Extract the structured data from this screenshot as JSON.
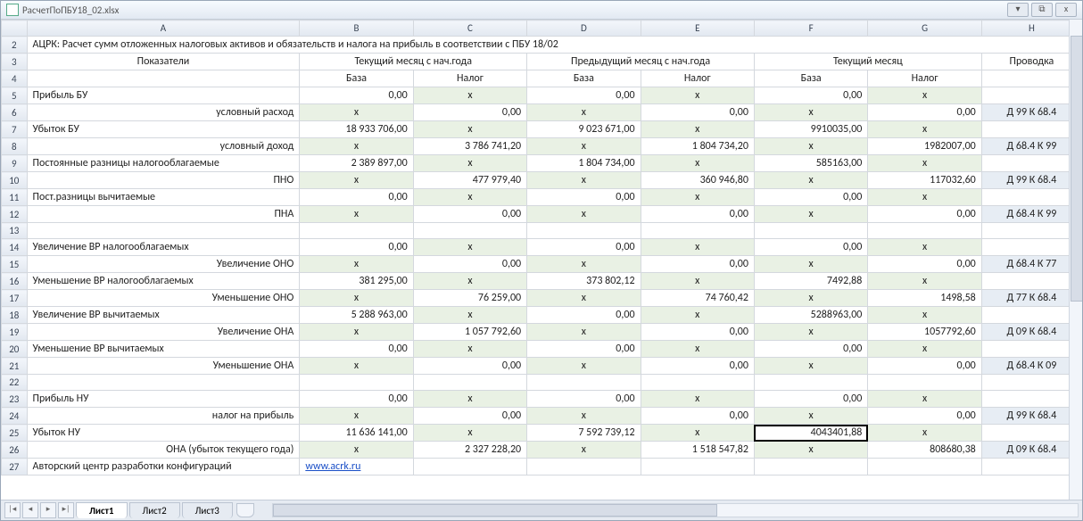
{
  "window": {
    "title": "РасчетПоПБУ18_02.xlsx",
    "btn_min": "▾",
    "btn_restore": "⧉",
    "btn_close": "x"
  },
  "columns": [
    "",
    "A",
    "B",
    "C",
    "D",
    "E",
    "F",
    "G",
    "H"
  ],
  "header_rows": {
    "r2": "АЦРК: Расчет сумм отложенных налоговых активов и обязательств и налога на прибыль в соответствии с ПБУ 18/02",
    "r3": {
      "A": "Показатели",
      "BC": "Текущий месяц с нач.года",
      "DE": "Предыдущий месяц с нач.года",
      "FG": "Текущий месяц",
      "H": "Проводка"
    },
    "r4": {
      "B": "База",
      "C": "Налог",
      "D": "База",
      "E": "Налог",
      "F": "База",
      "G": "Налог"
    }
  },
  "rows": [
    {
      "n": 5,
      "A": "Прибыль БУ",
      "Aalign": "left",
      "B": "0,00",
      "C": "x",
      "D": "0,00",
      "E": "x",
      "F": "0,00",
      "G": "x",
      "H": ""
    },
    {
      "n": 6,
      "A": "условный расход",
      "Aalign": "right",
      "B": "x",
      "C": "0,00",
      "D": "x",
      "E": "0,00",
      "F": "x",
      "G": "0,00",
      "H": "Д 99 К 68.4"
    },
    {
      "n": 7,
      "A": "Убыток БУ",
      "Aalign": "left",
      "B": "18 933 706,00",
      "C": "x",
      "D": "9 023 671,00",
      "E": "x",
      "F": "9910035,00",
      "G": "x",
      "H": ""
    },
    {
      "n": 8,
      "A": "условный доход",
      "Aalign": "right",
      "B": "x",
      "C": "3 786 741,20",
      "D": "x",
      "E": "1 804 734,20",
      "F": "x",
      "G": "1982007,00",
      "H": "Д 68.4 К 99"
    },
    {
      "n": 9,
      "A": "Постоянные разницы налогооблагаемые",
      "Aalign": "left",
      "B": "2 389 897,00",
      "C": "x",
      "D": "1 804 734,00",
      "E": "x",
      "F": "585163,00",
      "G": "x",
      "H": ""
    },
    {
      "n": 10,
      "A": "ПНО",
      "Aalign": "right",
      "B": "x",
      "C": "477 979,40",
      "D": "x",
      "E": "360 946,80",
      "F": "x",
      "G": "117032,60",
      "H": "Д 99 К 68.4"
    },
    {
      "n": 11,
      "A": "Пост.разницы вычитаемые",
      "Aalign": "left",
      "B": "0,00",
      "C": "x",
      "D": "0,00",
      "E": "x",
      "F": "0,00",
      "G": "x",
      "H": ""
    },
    {
      "n": 12,
      "A": "ПНА",
      "Aalign": "right",
      "B": "x",
      "C": "0,00",
      "D": "x",
      "E": "0,00",
      "F": "x",
      "G": "0,00",
      "H": "Д 68.4 К 99"
    },
    {
      "n": 13,
      "A": "",
      "Aalign": "left",
      "B": "",
      "C": "",
      "D": "",
      "E": "",
      "F": "",
      "G": "",
      "H": "",
      "blank": true
    },
    {
      "n": 14,
      "A": "Увеличение ВР налогооблагаемых",
      "Aalign": "left",
      "B": "0,00",
      "C": "x",
      "D": "0,00",
      "E": "x",
      "F": "0,00",
      "G": "x",
      "H": ""
    },
    {
      "n": 15,
      "A": "Увеличение ОНО",
      "Aalign": "right",
      "B": "x",
      "C": "0,00",
      "D": "x",
      "E": "0,00",
      "F": "x",
      "G": "0,00",
      "H": "Д 68.4 К 77"
    },
    {
      "n": 16,
      "A": "Уменьшение ВР налогооблагаемых",
      "Aalign": "left",
      "B": "381 295,00",
      "C": "x",
      "D": "373 802,12",
      "E": "x",
      "F": "7492,88",
      "G": "x",
      "H": ""
    },
    {
      "n": 17,
      "A": "Уменьшение ОНО",
      "Aalign": "right",
      "B": "x",
      "C": "76 259,00",
      "D": "x",
      "E": "74 760,42",
      "F": "x",
      "G": "1498,58",
      "H": "Д 77 К 68.4"
    },
    {
      "n": 18,
      "A": "Увеличение ВР вычитаемых",
      "Aalign": "left",
      "B": "5 288 963,00",
      "C": "x",
      "D": "0,00",
      "E": "x",
      "F": "5288963,00",
      "G": "x",
      "H": ""
    },
    {
      "n": 19,
      "A": "Увеличение ОНА",
      "Aalign": "right",
      "B": "x",
      "C": "1 057 792,60",
      "D": "x",
      "E": "0,00",
      "F": "x",
      "G": "1057792,60",
      "H": "Д 09 К 68.4"
    },
    {
      "n": 20,
      "A": "Уменьшение ВР вычитаемых",
      "Aalign": "left",
      "B": "0,00",
      "C": "x",
      "D": "0,00",
      "E": "x",
      "F": "0,00",
      "G": "x",
      "H": ""
    },
    {
      "n": 21,
      "A": "Уменьшение ОНА",
      "Aalign": "right",
      "B": "x",
      "C": "0,00",
      "D": "x",
      "E": "0,00",
      "F": "x",
      "G": "0,00",
      "H": "Д 68.4 К 09"
    },
    {
      "n": 22,
      "A": "",
      "Aalign": "left",
      "B": "",
      "C": "",
      "D": "",
      "E": "",
      "F": "",
      "G": "",
      "H": "",
      "blank": true
    },
    {
      "n": 23,
      "A": "Прибыль НУ",
      "Aalign": "left",
      "B": "0,00",
      "C": "x",
      "D": "0,00",
      "E": "x",
      "F": "0,00",
      "G": "x",
      "H": ""
    },
    {
      "n": 24,
      "A": "налог на прибыль",
      "Aalign": "right",
      "B": "x",
      "C": "0,00",
      "D": "x",
      "E": "0,00",
      "F": "x",
      "G": "0,00",
      "H": "Д 99 К 68.4"
    },
    {
      "n": 25,
      "A": "Убыток НУ",
      "Aalign": "left",
      "B": "11 636 141,00",
      "C": "x",
      "D": "7 592 739,12",
      "E": "x",
      "F": "4043401,88",
      "G": "x",
      "H": "",
      "selF": true
    },
    {
      "n": 26,
      "A": "ОНА (убыток текущего года)",
      "Aalign": "right",
      "B": "x",
      "C": "2 327 228,20",
      "D": "x",
      "E": "1 518 547,82",
      "F": "x",
      "G": "808680,38",
      "H": "Д 09 К 68.4"
    },
    {
      "n": 27,
      "A": "Авторский центр разработки конфигураций",
      "Aalign": "left",
      "B": "www.acrk.ru",
      "Blink": true,
      "C": "",
      "D": "",
      "E": "",
      "F": "",
      "G": "",
      "H": "",
      "blank": true
    }
  ],
  "tabs": {
    "nav_first": "|◂",
    "nav_prev": "◂",
    "nav_next": "▸",
    "nav_last": "▸|",
    "sheets": [
      {
        "label": "Лист1",
        "active": true
      },
      {
        "label": "Лист2",
        "active": false
      },
      {
        "label": "Лист3",
        "active": false
      }
    ]
  }
}
